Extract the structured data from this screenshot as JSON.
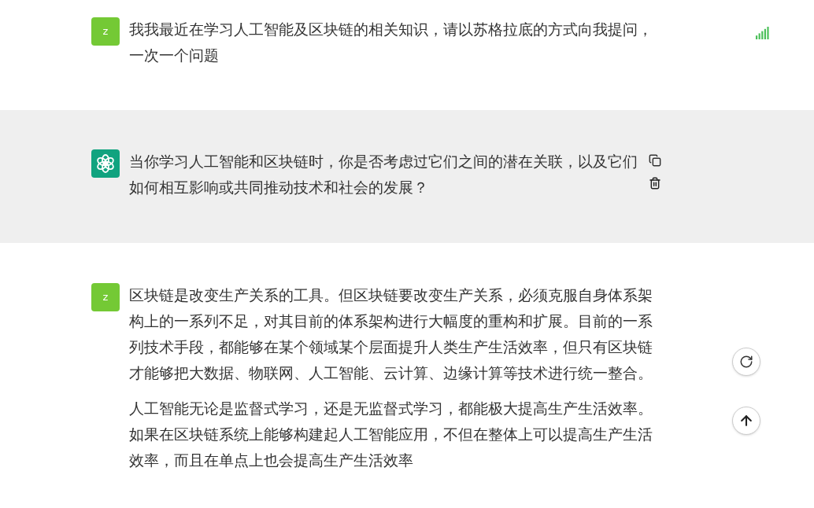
{
  "messages": [
    {
      "kind": "user",
      "avatar": "z",
      "paragraphs": [
        [
          "我我最近在学习人工智能及区块链的相关知识，请以苏格拉底的方式向我提问，",
          "一次一个问题"
        ]
      ]
    },
    {
      "kind": "assistant",
      "paragraphs": [
        [
          "当你学习人工智能和区块链时，你是否考虑过它们之间的潜在关联，以及它们",
          "如何相互影响或共同推动技术和社会的发展？"
        ]
      ]
    },
    {
      "kind": "user",
      "avatar": "z",
      "paragraphs": [
        [
          "区块链是改变生产关系的工具。但区块链要改变生产关系，必须克服自身体系架",
          "构上的一系列不足，对其目前的体系架构进行大幅度的重构和扩展。目前的一系",
          "列技术手段，都能够在某个领域某个层面提升人类生产生活效率，但只有区块链",
          "才能够把大数据、物联网、人工智能、云计算、边缘计算等技术进行统一整合。"
        ],
        [
          "人工智能无论是监督式学习，还是无监督式学习，都能极大提高生产生活效率。",
          "如果在区块链系统上能够构建起人工智能应用，不但在整体上可以提高生产生活",
          "效率，而且在单点上也会提高生产生活效率"
        ]
      ]
    }
  ]
}
